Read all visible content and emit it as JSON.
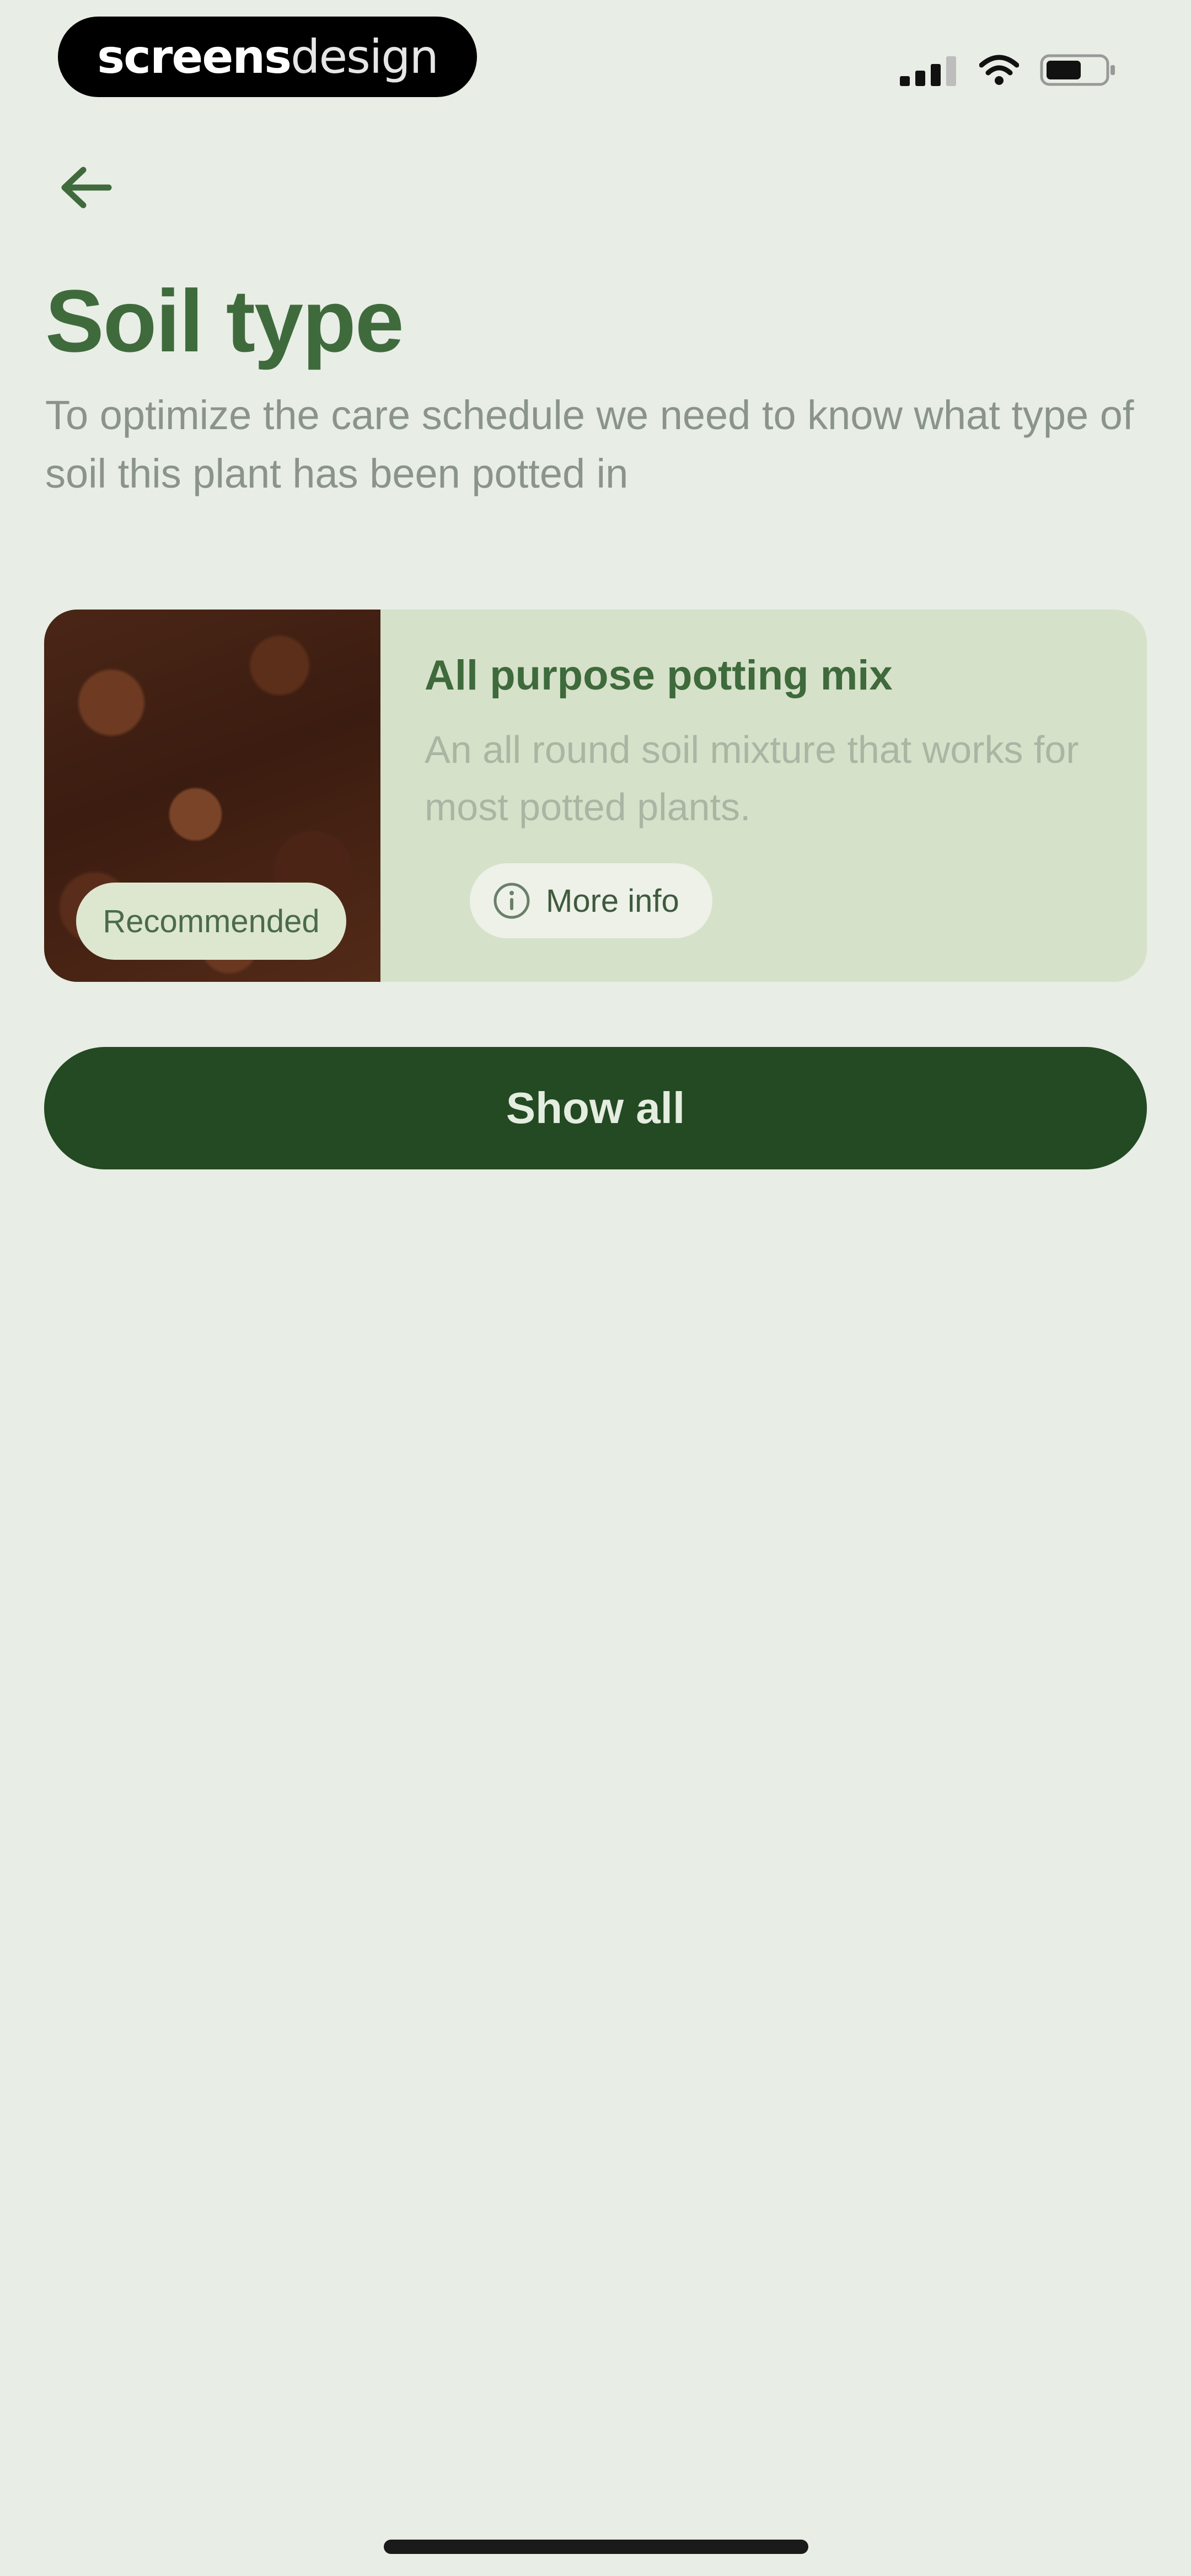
{
  "status_bar": {
    "brand_bold": "screens",
    "brand_light": "design",
    "icons": [
      "signal-icon",
      "wifi-icon",
      "battery-icon"
    ]
  },
  "nav": {
    "back_icon": "arrow-left-icon"
  },
  "header": {
    "title": "Soil type",
    "subtitle": "To optimize the care schedule we need to know what type of soil this plant has been potted in"
  },
  "soil_card": {
    "badge": "Recommended",
    "title": "All purpose potting mix",
    "description": "An all round soil mixture that works for most potted plants.",
    "more_info_label": "More info",
    "more_info_icon": "info-icon",
    "image": "soil-image"
  },
  "actions": {
    "show_all_label": "Show all"
  },
  "colors": {
    "background": "#e8ede5",
    "accent": "#3f6b3c",
    "primary_button": "#234a22",
    "card": "#d6e1c9"
  }
}
